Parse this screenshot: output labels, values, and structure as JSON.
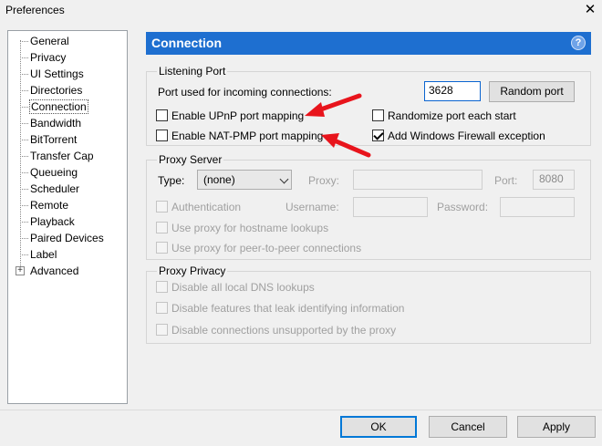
{
  "window": {
    "title": "Preferences"
  },
  "sidebar": {
    "items": [
      {
        "label": "General"
      },
      {
        "label": "Privacy"
      },
      {
        "label": "UI Settings"
      },
      {
        "label": "Directories"
      },
      {
        "label": "Connection"
      },
      {
        "label": "Bandwidth"
      },
      {
        "label": "BitTorrent"
      },
      {
        "label": "Transfer Cap"
      },
      {
        "label": "Queueing"
      },
      {
        "label": "Scheduler"
      },
      {
        "label": "Remote"
      },
      {
        "label": "Playback"
      },
      {
        "label": "Paired Devices"
      },
      {
        "label": "Label"
      },
      {
        "label": "Advanced"
      }
    ],
    "selected": "Connection"
  },
  "header": {
    "title": "Connection",
    "help_icon": "?"
  },
  "listening": {
    "legend": "Listening Port",
    "port_label": "Port used for incoming connections:",
    "port_value": "3628",
    "random_port_button": "Random port",
    "upnp_label": "Enable UPnP port mapping",
    "natpmp_label": "Enable NAT-PMP port mapping",
    "randomize_label": "Randomize port each start",
    "firewall_label": "Add Windows Firewall exception"
  },
  "proxy": {
    "legend": "Proxy Server",
    "type_label": "Type:",
    "type_value": "(none)",
    "proxy_label": "Proxy:",
    "port_label": "Port:",
    "port_value": "8080",
    "auth_label": "Authentication",
    "username_label": "Username:",
    "password_label": "Password:",
    "hostname_label": "Use proxy for hostname lookups",
    "p2p_label": "Use proxy for peer-to-peer connections"
  },
  "privacy": {
    "legend": "Proxy Privacy",
    "dns_label": "Disable all local DNS lookups",
    "leak_label": "Disable features that leak identifying information",
    "unsupported_label": "Disable connections unsupported by the proxy"
  },
  "footer": {
    "ok": "OK",
    "cancel": "Cancel",
    "apply": "Apply"
  },
  "colors": {
    "header_bg": "#1e6fd0",
    "annotation_arrow": "#e8141c"
  }
}
